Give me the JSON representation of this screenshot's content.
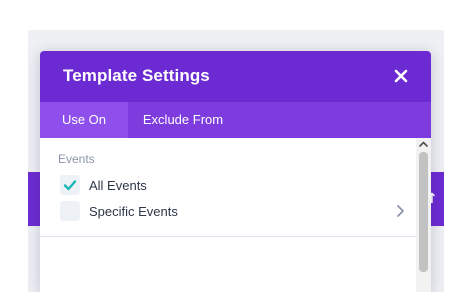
{
  "modal": {
    "title": "Template Settings",
    "tabs": [
      {
        "label": "Use On",
        "active": true
      },
      {
        "label": "Exclude From",
        "active": false
      }
    ],
    "section_label": "Events",
    "options": [
      {
        "label": "All Events",
        "checked": true
      },
      {
        "label": "Specific Events",
        "checked": false,
        "has_submenu": true
      }
    ]
  },
  "icons": {
    "close": "close-icon",
    "check": "checkmark-icon",
    "chevron": "chevron-right-icon",
    "scroll_up": "scroll-up-arrow-icon",
    "background_sort": "sort-icon"
  },
  "colors": {
    "header": "#6c2bd2",
    "tab_bar": "#7e3bdd",
    "active_tab": "#8f4fec",
    "check": "#19b6b6",
    "label_muted": "#8b95a8",
    "text": "#2d3748"
  }
}
